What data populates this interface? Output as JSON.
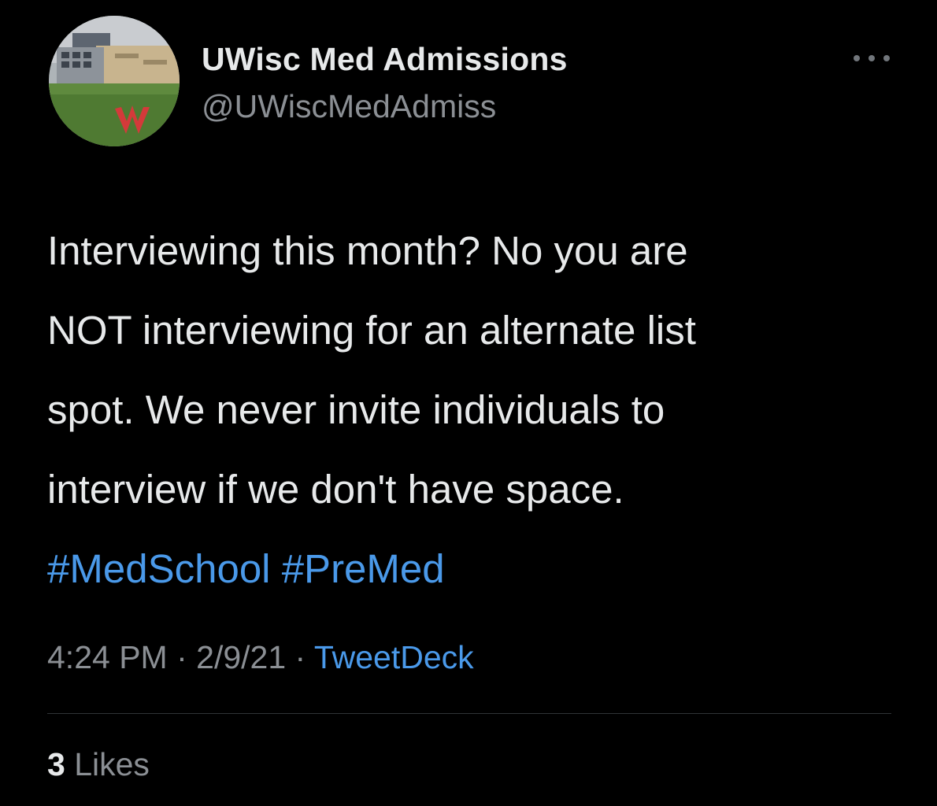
{
  "author": {
    "display_name": "UWisc Med Admissions",
    "handle": "@UWiscMedAdmiss",
    "avatar_icon": "building-photo-avatar"
  },
  "more_icon": "more-dots-icon",
  "tweet": {
    "lines": [
      "Interviewing this month? No you are",
      "NOT interviewing for an alternate list",
      "spot. We never invite individuals to",
      "interview if we don't have space."
    ],
    "hashtags": [
      "#MedSchool",
      "#PreMed"
    ]
  },
  "meta": {
    "time": "4:24 PM",
    "separator": " · ",
    "date": "2/9/21",
    "source": "TweetDeck"
  },
  "likes": {
    "count": "3",
    "label": "Likes"
  },
  "colors": {
    "background": "#000000",
    "text": "#e7e9ea",
    "secondary": "#8b8f94",
    "link": "#4a99e9",
    "divider": "#2f3336"
  }
}
